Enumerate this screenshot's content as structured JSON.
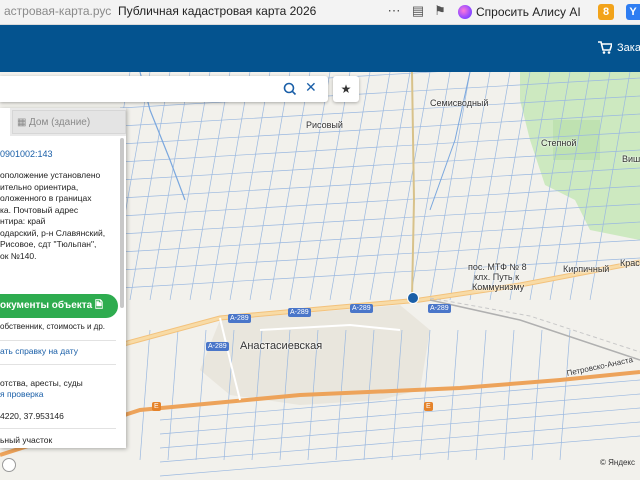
{
  "browser": {
    "url_text": "астровая-карта.рус",
    "tab_title": "Публичная кадастровая карта 2026",
    "alice_label": "Спросить Алису AI",
    "badge_number": "8",
    "badge_letter": "Y"
  },
  "header": {
    "orders_label": "Заказы",
    "background_color": "#04538f"
  },
  "search": {
    "value": "",
    "search_icon": "search-icon",
    "clear_icon": "close-icon"
  },
  "panel": {
    "tab_house_label": "Дом (здание)",
    "cadastral_number": "0901002:143",
    "address_lines": [
      "оположение установлено",
      "ительно ориентира,",
      "оложенного в границах",
      "ка. Почтовый адрес",
      "нтира: край",
      "одарский, р-н Славянский,",
      "Рисовое, сдт \"Тюльпан\",",
      "ок №140."
    ],
    "documents_button": "окументы объекта",
    "documents_sub": "обственник, стоимость и др.",
    "reference_link": "ать справку на дату",
    "encumbrances_text": "отства, аресты, суды",
    "check_link": "я проверка",
    "coordinates_text": "4220, 37.953146",
    "land_type_text": "ьный участок",
    "accent_color": "#2eac4f"
  },
  "map": {
    "labels": {
      "risoviy": "Рисовый",
      "semivodny": "Семисводный",
      "stepnoy": "Степной",
      "vish": "Виш",
      "mtf": "пос. МТФ № 8",
      "put": "клх. Путь к",
      "kommunizmu": "Коммунизму",
      "kirpichny": "Кирпичный",
      "krasn": "Крас",
      "anastasievskaya": "Анастасиевская",
      "petrovsko": "Петровско-Анаста"
    },
    "road_shields": [
      "A-289",
      "A-289",
      "A-289",
      "A-289",
      "A-289"
    ],
    "road_e_shield": "E",
    "copyright": "© Яндекс"
  }
}
